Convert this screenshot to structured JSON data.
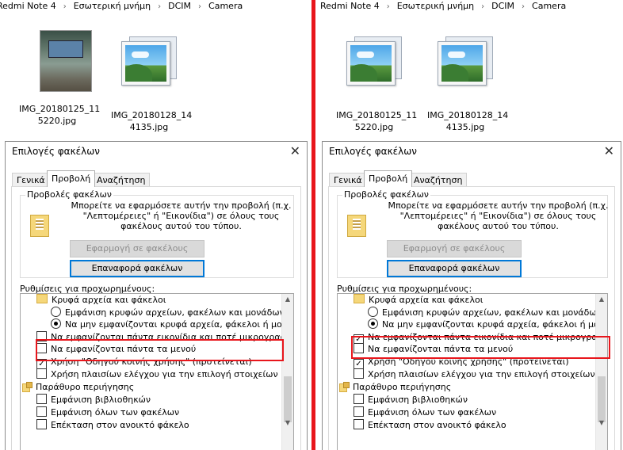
{
  "breadcrumb": {
    "segments": [
      "Redmi Note 4",
      "Εσωτερική μνήμη",
      "DCIM",
      "Camera"
    ]
  },
  "colors": {
    "divider": "#e8161c",
    "highlight": "#e8161c",
    "focus_border": "#0078d7"
  },
  "left": {
    "files": [
      {
        "name_line1": "IMG_20180125_11",
        "name_line2": "5220.jpg",
        "thumbnail": "photo-preview"
      },
      {
        "name_line1": "IMG_20180128_14",
        "name_line2": "4135.jpg",
        "thumbnail": "generic-photo-icon"
      }
    ]
  },
  "right": {
    "files": [
      {
        "name_line1": "IMG_20180125_11",
        "name_line2": "5220.jpg",
        "thumbnail": "generic-photo-icon"
      },
      {
        "name_line1": "IMG_20180128_14",
        "name_line2": "4135.jpg",
        "thumbnail": "generic-photo-icon"
      }
    ]
  },
  "dialog": {
    "title": "Επιλογές φακέλων",
    "close_glyph": "✕",
    "tabs": [
      "Γενικά",
      "Προβολή",
      "Αναζήτηση"
    ],
    "active_tab": "Προβολή",
    "folder_views": {
      "group_title": "Προβολές φακέλων",
      "line1": "Μπορείτε να εφαρμόσετε αυτήν την προβολή (π.χ.",
      "line2": "\"Λεπτομέρειες\" ή \"Εικονίδια\") σε όλους τους",
      "line3": "φακέλους αυτού του τύπου.",
      "apply_button": "Εφαρμογή σε φακέλους",
      "reset_button": "Επαναφορά φακέλων"
    },
    "advanced_label": "Ρυθμίσεις για προχωρημένους:",
    "tree": {
      "hidden_folder": "Κρυφά αρχεία και φάκελοι",
      "show_hidden": "Εμφάνιση κρυφών αρχείων, φακέλων και μονάδων",
      "dont_show_hidden": "Να μην εμφανίζονται κρυφά αρχεία, φάκελοι ή μο",
      "always_icons": "Να εμφανίζονται πάντα εικονίδια και ποτέ μικρογραφ",
      "always_menus": "Να εμφανίζονται πάντα τα μενού",
      "sharing_wizard": "Χρήση \"Οδηγού κοινής χρήσης\" (προτείνεται)",
      "item_checkboxes": "Χρήση πλαισίων ελέγχου για την επιλογή στοιχείων",
      "nav_pane": "Παράθυρο περιήγησης",
      "show_libraries": "Εμφάνιση βιβλιοθηκών",
      "show_all_folders": "Εμφάνιση όλων των φακέλων",
      "expand_folder": "Επέκταση στον ανοικτό φάκελο"
    },
    "checked_left": {
      "always_icons": false,
      "always_menus": false,
      "sharing_wizard": true,
      "item_checkboxes": false,
      "show_libraries": false,
      "show_all_folders": false,
      "expand_folder": false
    },
    "checked_right": {
      "always_icons": true,
      "always_menus": false,
      "sharing_wizard": true,
      "item_checkboxes": false,
      "show_libraries": false,
      "show_all_folders": false,
      "expand_folder": false
    },
    "check_glyph": "✓",
    "scroll_up_glyph": "▲",
    "scroll_down_glyph": "▼"
  }
}
